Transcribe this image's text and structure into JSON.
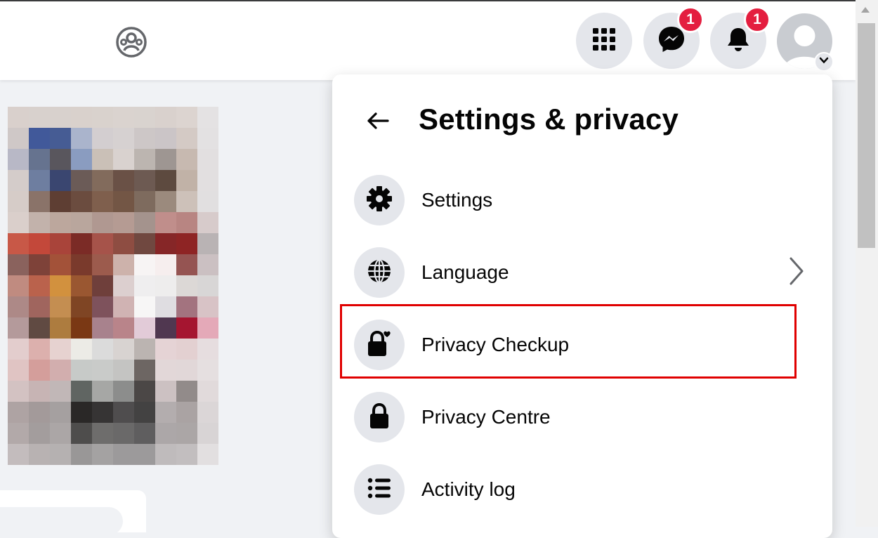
{
  "topbar": {
    "groups_icon": "groups-icon",
    "menu_icon": "grid-menu-icon",
    "messenger": {
      "icon": "messenger-icon",
      "badge": "1"
    },
    "notifications": {
      "icon": "bell-icon",
      "badge": "1"
    },
    "account_icon": "avatar"
  },
  "colors": {
    "badge": "#e41e3f",
    "icon_bg": "#e4e6eb",
    "highlight": "#e00000",
    "page_bg": "#f0f2f5"
  },
  "menu": {
    "title": "Settings & privacy",
    "back_icon": "back-arrow-icon",
    "items": [
      {
        "label": "Settings",
        "icon": "gear-icon"
      },
      {
        "label": "Language",
        "icon": "globe-icon",
        "has_chevron": true
      },
      {
        "label": "Privacy Checkup",
        "icon": "lock-heart-icon",
        "highlighted": true
      },
      {
        "label": "Privacy Centre",
        "icon": "lock-icon"
      },
      {
        "label": "Activity log",
        "icon": "list-icon"
      }
    ]
  }
}
